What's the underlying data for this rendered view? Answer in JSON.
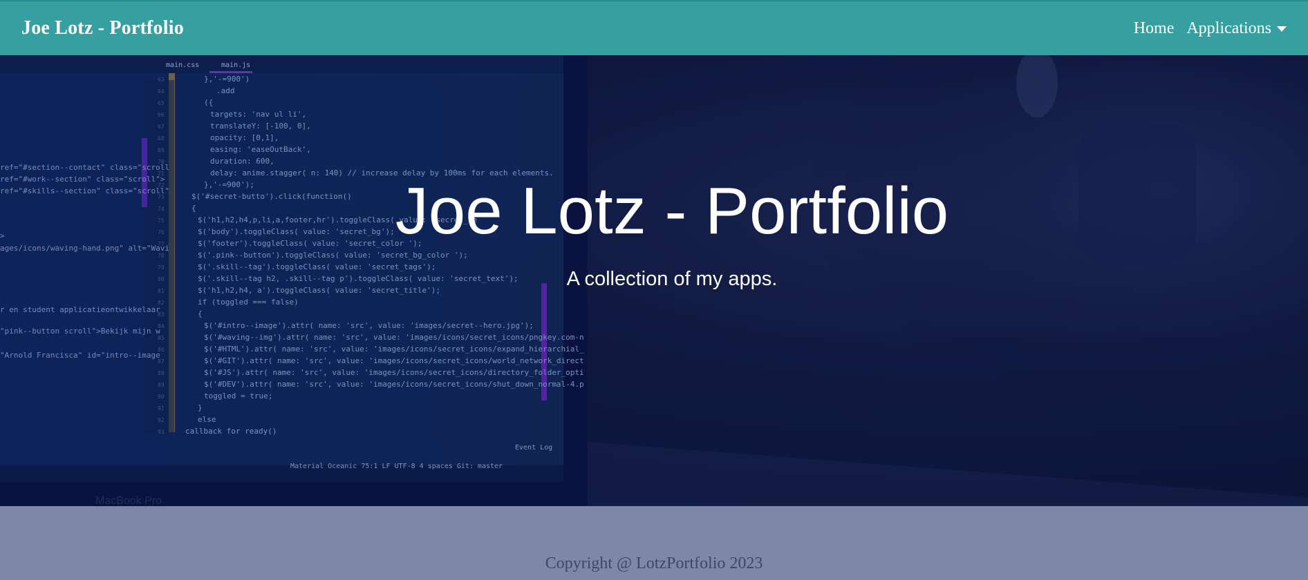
{
  "navbar": {
    "brand": "Joe Lotz - Portfolio",
    "links": [
      {
        "label": "Home"
      },
      {
        "label": "Applications"
      }
    ]
  },
  "hero": {
    "title": "Joe Lotz - Portfolio",
    "subtitle": "A collection of my apps.",
    "background": {
      "tabs": [
        "main.css",
        "main.js"
      ],
      "code_lines": [
        "},'-=900')",
        ".add",
        "({",
        "targets: 'nav ul li',",
        "translateY: [-100, 0],",
        "opacity: [0,1],",
        "easing: 'easeOutBack',",
        "duration: 600,",
        "delay: anime.stagger( n: 140) // increase delay by 100ms for each elements.",
        "},'-=900');",
        "$('#secret-butto').click(function()",
        "{",
        "$('h1,h2,h4,p,li,a,footer,hr').toggleClass( value: 'secret_te",
        "$('body').toggleClass( value: 'secret_bg');",
        "$('footer').toggleClass( value: 'secret_color ');",
        "$('.pink--button').toggleClass( value: 'secret_bg_color ');",
        "$('.skill--tag').toggleClass( value: 'secret_tags');",
        "$('.skill--tag h2, .skill--tag p').toggleClass( value: 'secret_text');",
        "$('h1,h2,h4, a').toggleClass( value: 'secret_title');",
        "if (toggled === false)",
        "{",
        "$('#intro--image').attr( name: 'src',  value: 'images/secret--hero.jpg');",
        "$('#waving--img').attr( name: 'src',  value: 'images/icons/secret_icons/pngkey.com-n",
        "$('#HTML').attr( name: 'src',  value: 'images/icons/secret_icons/expand_hierarchial_",
        "$('#GIT').attr( name: 'src',  value: 'images/icons/secret_icons/world_network_direct",
        "$('#JS').attr( name: 'src',  value: 'images/icons/secret_icons/directory_folder_opti",
        "$('#DEV').attr( name: 'src',  value: 'images/icons/secret_icons/shut_down_normal-4.p",
        "toggled = true;",
        "}",
        "else",
        "callback for ready()"
      ],
      "left_code": [
        "ref=\"#section--contact\" class=\"scroll",
        "ref=\"#work--section\" class=\"scroll\">",
        "ref=\"#skills--section\" class=\"scroll\"",
        ">",
        "ages/icons/waving-hand.png\" alt=\"Wavi",
        "r en student applicatieontwikkelaar",
        "\"pink--button scroll\">Bekijk mijn w",
        "\"Arnold Francisca\" id=\"intro--image"
      ],
      "status_bar": "Material Oceanic   75:1  LF  UTF-8  4 spaces  Git: master",
      "event_log": "Event Log",
      "laptop_label": "MacBook Pro"
    }
  },
  "footer": {
    "copyright": "Copyright @ LotzPortfolio 2023"
  }
}
